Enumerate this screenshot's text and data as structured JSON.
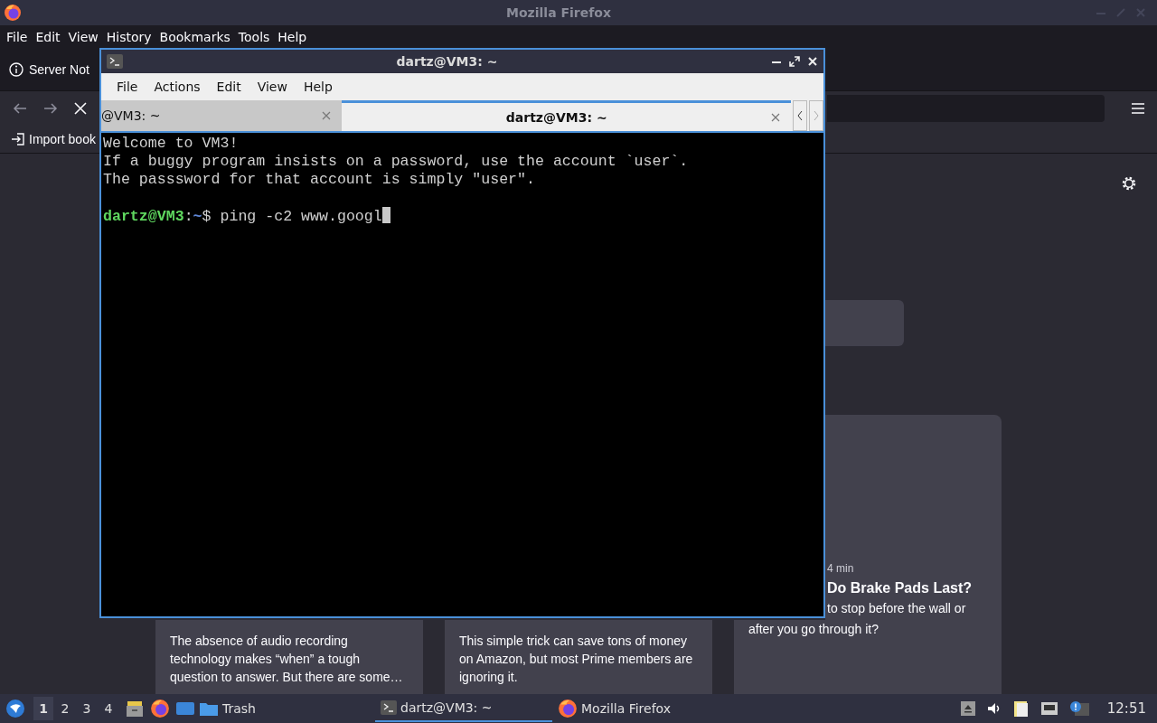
{
  "firefox": {
    "title": "Mozilla Firefox",
    "menu": [
      "File",
      "Edit",
      "View",
      "History",
      "Bookmarks",
      "Tools",
      "Help"
    ],
    "tab_title": "Server Not",
    "bookmark": "Import book",
    "cards": [
      {
        "kind": "text",
        "text": "The absence of audio recording technology makes “when” a tough question to answer. But there are some…"
      },
      {
        "kind": "text",
        "text": "This simple trick can save tons of money on Amazon, but most Prime members are ignoring it."
      },
      {
        "kind": "story",
        "meta": "4 min",
        "title": "Do Brake Pads Last?",
        "lines": [
          "to stop before the wall or",
          "after you go through it?"
        ]
      }
    ]
  },
  "terminal": {
    "title": "dartz@VM3: ~",
    "menu": [
      "File",
      "Actions",
      "Edit",
      "View",
      "Help"
    ],
    "tabs": [
      {
        "label": "@VM3: ~",
        "selected": false
      },
      {
        "label": "dartz@VM3: ~",
        "selected": true
      }
    ],
    "lines": [
      "Welcome to VM3!",
      "If a buggy program insists on a password, use the account `user`.",
      "The passsword for that account is simply \"user\"."
    ],
    "prompt": {
      "user": "dartz@VM3",
      "colon": ":",
      "path": "~",
      "symbol": "$",
      "command": "ping -c2 www.googl"
    }
  },
  "taskbar": {
    "workspaces": [
      {
        "label": "1",
        "selected": true
      },
      {
        "label": "2",
        "selected": false
      },
      {
        "label": "3",
        "selected": false
      },
      {
        "label": "4",
        "selected": false
      }
    ],
    "launcher": "Trash",
    "tasks": [
      {
        "label": "dartz@VM3: ~",
        "kind": "terminal",
        "selected": true
      },
      {
        "label": "Mozilla Firefox",
        "kind": "firefox",
        "selected": false
      }
    ],
    "clock": "12:51"
  }
}
